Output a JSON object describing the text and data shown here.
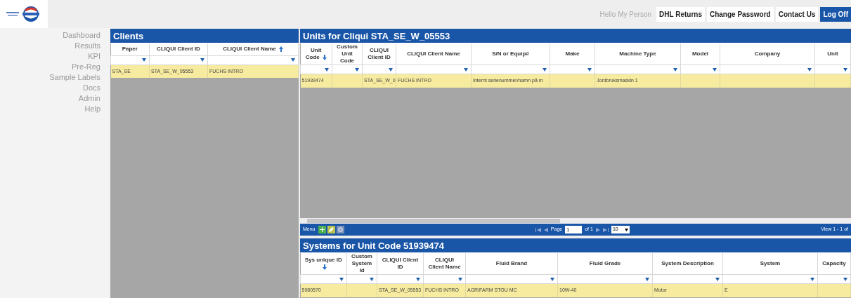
{
  "header": {
    "greeting": "Hello",
    "user": "My Person",
    "links": [
      {
        "label": "DHL Returns",
        "kind": "link"
      },
      {
        "label": "Change Password",
        "kind": "link"
      },
      {
        "label": "Contact Us",
        "kind": "link"
      },
      {
        "label": "Log Off",
        "kind": "primary"
      }
    ]
  },
  "sidebar": {
    "items": [
      {
        "label": "Dashboard"
      },
      {
        "label": "Results"
      },
      {
        "label": "KPI"
      },
      {
        "label": "Pre-Reg"
      },
      {
        "label": "Sample Labels"
      },
      {
        "label": "Docs"
      },
      {
        "label": "Admin"
      },
      {
        "label": "Help"
      }
    ]
  },
  "clients": {
    "title": "Clients",
    "columns": [
      {
        "label": "Paper",
        "sorted": false
      },
      {
        "label": "CLIQUI Client ID",
        "sorted": false
      },
      {
        "label": "CLIQUI Client Name",
        "sorted": true,
        "descending": false
      }
    ],
    "rows": [
      {
        "selected": true,
        "cells": [
          "STA_SE",
          "STA_SE_W_05553",
          "FUCHS INTRO"
        ]
      }
    ]
  },
  "units": {
    "title": "Units for Cliqui STA_SE_W_05553",
    "columns": [
      {
        "label": "Unit Code",
        "sorted": true,
        "descending": true
      },
      {
        "label": "Custom Unit Code",
        "sorted": false
      },
      {
        "label": "CLIQUI Client ID",
        "sorted": false
      },
      {
        "label": "CLIQUI Client Name",
        "sorted": false
      },
      {
        "label": "S/N or Equip#",
        "sorted": false
      },
      {
        "label": "Make",
        "sorted": false
      },
      {
        "label": "Machine Type",
        "sorted": false
      },
      {
        "label": "Model",
        "sorted": false
      },
      {
        "label": "Company",
        "sorted": false
      },
      {
        "label": "Unit",
        "sorted": false
      }
    ],
    "rows": [
      {
        "selected": true,
        "cells": [
          "51939474",
          "",
          "STA_SE_W_0",
          "FUCHS INTRO",
          "Internt serienummer/namn på m",
          "",
          "Jordbruksmaskin 1",
          "",
          "",
          ""
        ]
      }
    ],
    "pager": {
      "menu": "Menu",
      "page_label": "Page",
      "page": "1",
      "of": "of 1",
      "page_size": "10",
      "view": "View 1 - 1 of"
    }
  },
  "systems": {
    "title": "Systems for Unit Code 51939474",
    "columns": [
      {
        "label": "Sys unique ID",
        "sorted": true,
        "descending": true
      },
      {
        "label": "Custom System Id",
        "sorted": false
      },
      {
        "label": "CLIQUI Client ID",
        "sorted": false
      },
      {
        "label": "CLIQUI Client Name",
        "sorted": false
      },
      {
        "label": "Fluid Brand",
        "sorted": false
      },
      {
        "label": "Fluid Grade",
        "sorted": false
      },
      {
        "label": "System Description",
        "sorted": false
      },
      {
        "label": "System",
        "sorted": false
      },
      {
        "label": "Capacity",
        "sorted": false
      }
    ],
    "rows": [
      {
        "selected": true,
        "cells": [
          "5980570",
          "",
          "STA_SE_W_05553",
          "FUCHS INTRO",
          "AGRIFARM STOU MC",
          "10W-40",
          "Motor",
          "E",
          ""
        ]
      }
    ]
  }
}
